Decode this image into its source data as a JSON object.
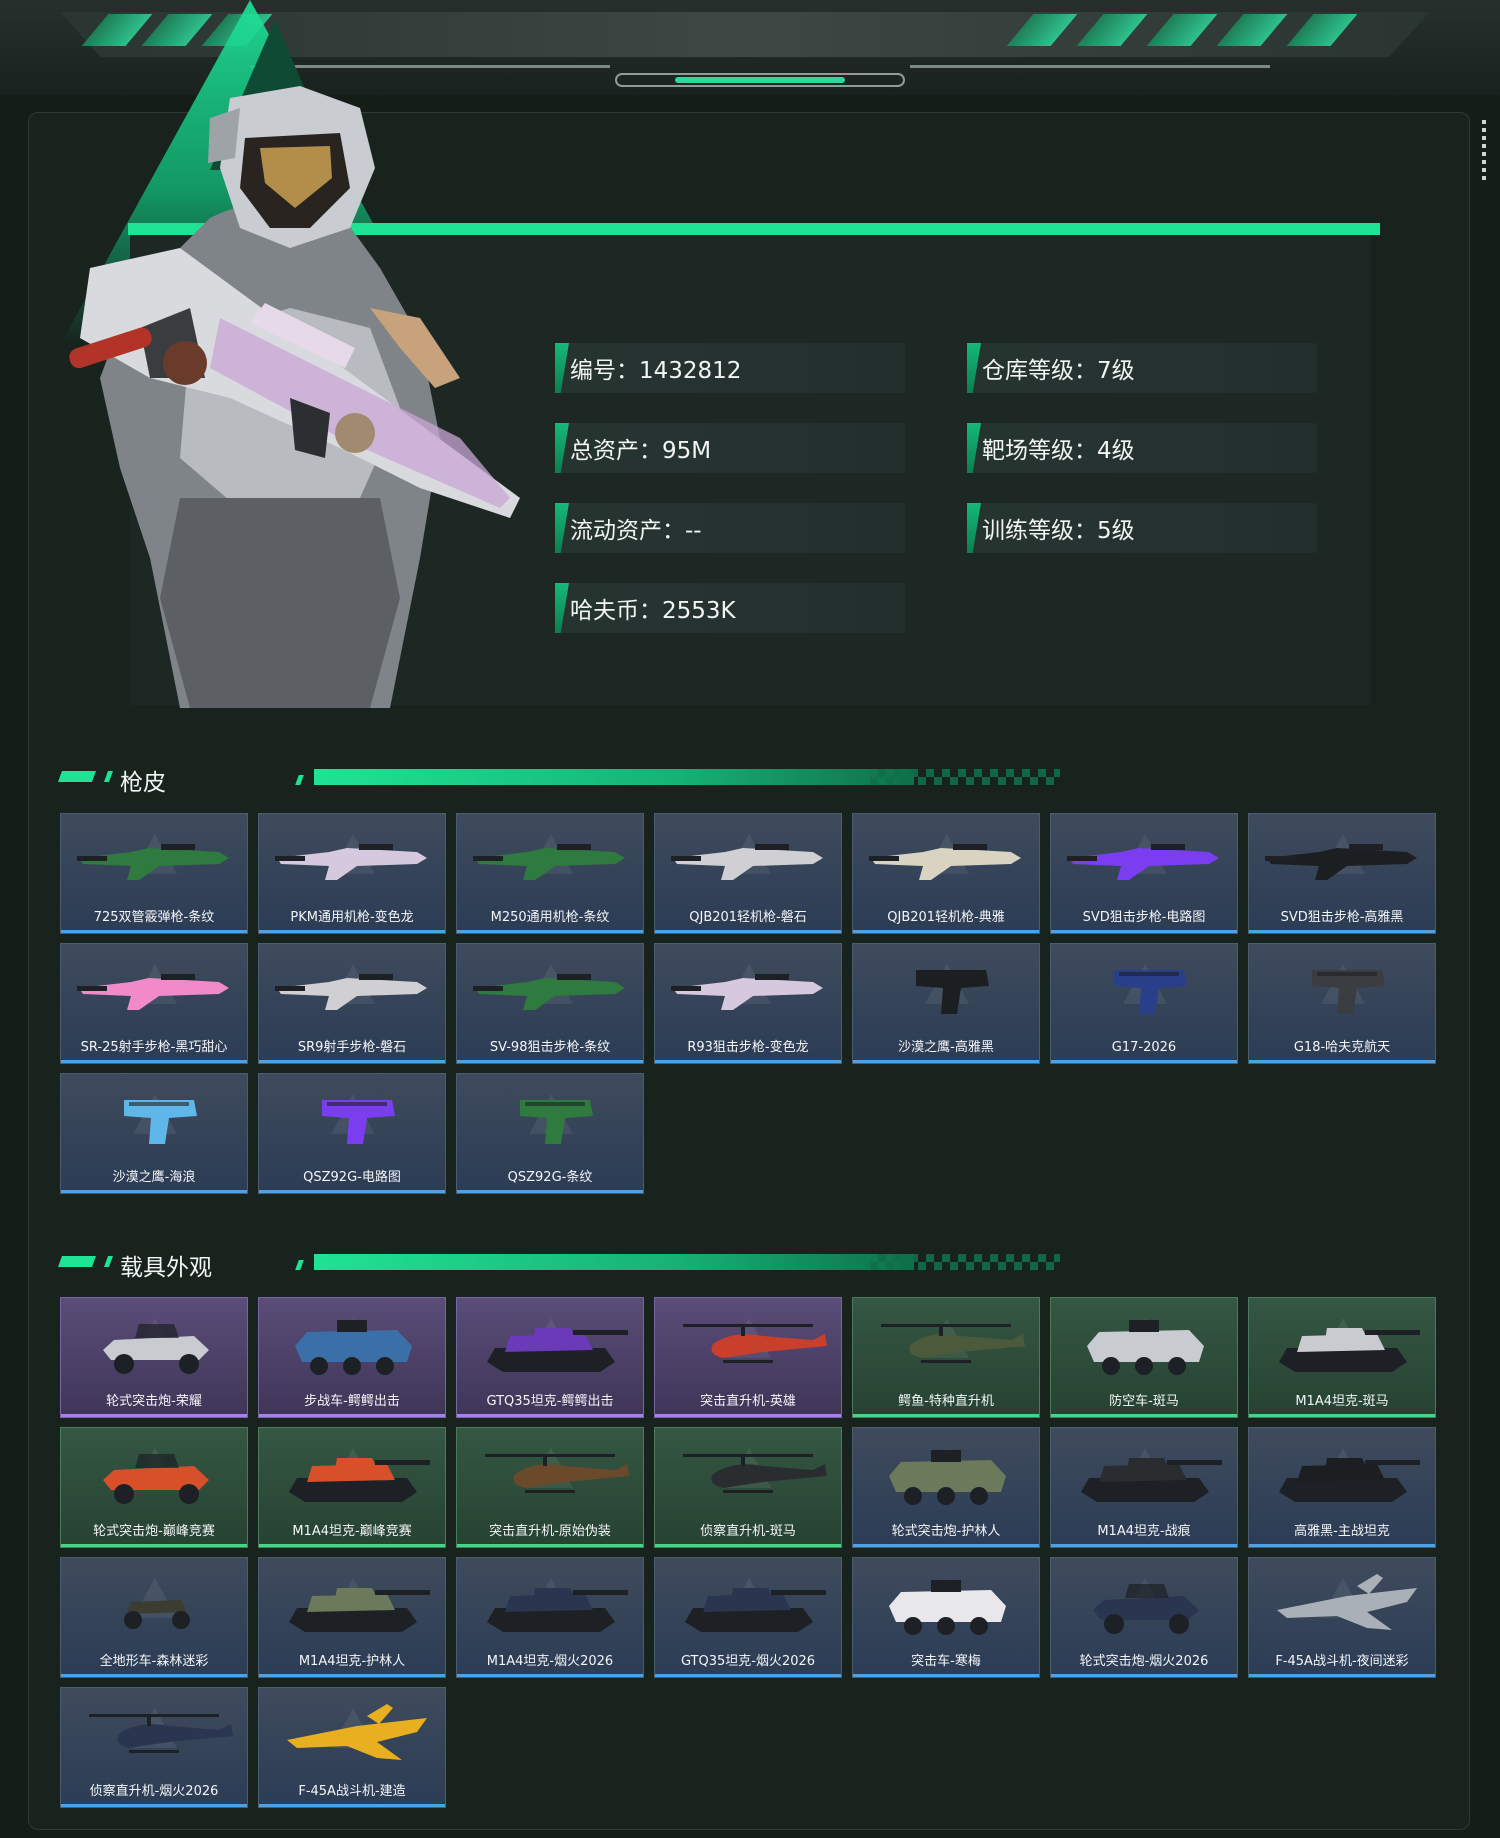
{
  "profile": {
    "stats": [
      {
        "label": "编号：1432812"
      },
      {
        "label": "仓库等级：7级"
      },
      {
        "label": "总资产：95M"
      },
      {
        "label": "靶场等级：4级"
      },
      {
        "label": "流动资产：--"
      },
      {
        "label": "训练等级：5级"
      },
      {
        "label": "哈夫币：2553K"
      }
    ]
  },
  "sections": {
    "skins_title": "枪皮",
    "vehicles_title": "载具外观"
  },
  "skins": [
    {
      "name": "725双管霰弹枪-条纹",
      "kind": "gun",
      "tint": "blue",
      "color": "#2f7a3e"
    },
    {
      "name": "PKM通用机枪-变色龙",
      "kind": "gun",
      "tint": "blue",
      "color": "#d6c8df"
    },
    {
      "name": "M250通用机枪-条纹",
      "kind": "gun",
      "tint": "blue",
      "color": "#2f7a3e"
    },
    {
      "name": "QJB201轻机枪-磐石",
      "kind": "gun",
      "tint": "blue",
      "color": "#d0d0d4"
    },
    {
      "name": "QJB201轻机枪-典雅",
      "kind": "gun",
      "tint": "blue",
      "color": "#d9d3c2"
    },
    {
      "name": "SVD狙击步枪-电路图",
      "kind": "gun",
      "tint": "blue",
      "color": "#7a3ef0"
    },
    {
      "name": "SVD狙击步枪-高雅黑",
      "kind": "gun",
      "tint": "blue",
      "color": "#1c1f22"
    },
    {
      "name": "SR-25射手步枪-黑巧甜心",
      "kind": "gun",
      "tint": "blue",
      "color": "#f08ac8"
    },
    {
      "name": "SR9射手步枪-磐石",
      "kind": "gun",
      "tint": "blue",
      "color": "#d0d0d4"
    },
    {
      "name": "SV-98狙击步枪-条纹",
      "kind": "gun",
      "tint": "blue",
      "color": "#2f7a3e"
    },
    {
      "name": "R93狙击步枪-变色龙",
      "kind": "gun",
      "tint": "blue",
      "color": "#d6c8df"
    },
    {
      "name": "沙漠之鹰-高雅黑",
      "kind": "pistol",
      "tint": "blue",
      "color": "#1c1f22"
    },
    {
      "name": "G17-2026",
      "kind": "pistol",
      "tint": "blue",
      "color": "#2a3f8a"
    },
    {
      "name": "G18-哈夫克航天",
      "kind": "pistol",
      "tint": "blue",
      "color": "#3a3d42"
    },
    {
      "name": "沙漠之鹰-海浪",
      "kind": "pistol",
      "tint": "blue",
      "color": "#5fb6e8"
    },
    {
      "name": "QSZ92G-电路图",
      "kind": "pistol",
      "tint": "blue",
      "color": "#7a3ef0"
    },
    {
      "name": "QSZ92G-条纹",
      "kind": "pistol",
      "tint": "blue",
      "color": "#2f7a3e"
    }
  ],
  "vehicles": [
    {
      "name": "轮式突击炮-荣耀",
      "kind": "buggy",
      "tint": "purple",
      "color": "#c8ccd0"
    },
    {
      "name": "步战车-鳄鳄出击",
      "kind": "apc",
      "tint": "purple",
      "color": "#3a6fa8"
    },
    {
      "name": "GTQ35坦克-鳄鳄出击",
      "kind": "tank",
      "tint": "purple",
      "color": "#6a3ab8"
    },
    {
      "name": "突击直升机-英雄",
      "kind": "heli",
      "tint": "purple",
      "color": "#c8402c"
    },
    {
      "name": "鳄鱼-特种直升机",
      "kind": "heli",
      "tint": "green",
      "color": "#4a5a3a"
    },
    {
      "name": "防空车-斑马",
      "kind": "apc",
      "tint": "green",
      "color": "#c8ccd0"
    },
    {
      "name": "M1A4坦克-斑马",
      "kind": "tank",
      "tint": "green",
      "color": "#c8ccd0"
    },
    {
      "name": "轮式突击炮-巅峰竞赛",
      "kind": "buggy",
      "tint": "green",
      "color": "#d8502a"
    },
    {
      "name": "M1A4坦克-巅峰竞赛",
      "kind": "tank",
      "tint": "green",
      "color": "#d8502a"
    },
    {
      "name": "突击直升机-原始伪装",
      "kind": "heli",
      "tint": "green",
      "color": "#6a4a2a"
    },
    {
      "name": "侦察直升机-斑马",
      "kind": "heli",
      "tint": "green",
      "color": "#2a2d30"
    },
    {
      "name": "轮式突击炮-护林人",
      "kind": "apc",
      "tint": "blue",
      "color": "#6a7a5a"
    },
    {
      "name": "M1A4坦克-战痕",
      "kind": "tank",
      "tint": "blue",
      "color": "#2a2d30"
    },
    {
      "name": "高雅黑-主战坦克",
      "kind": "tank",
      "tint": "blue",
      "color": "#1c1f22"
    },
    {
      "name": "全地形车-森林迷彩",
      "kind": "atv",
      "tint": "blue",
      "color": "#3a3d30"
    },
    {
      "name": "M1A4坦克-护林人",
      "kind": "tank",
      "tint": "blue",
      "color": "#6a7a5a"
    },
    {
      "name": "M1A4坦克-烟火2026",
      "kind": "tank",
      "tint": "blue",
      "color": "#2a3550"
    },
    {
      "name": "GTQ35坦克-烟火2026",
      "kind": "tank",
      "tint": "blue",
      "color": "#2a3550"
    },
    {
      "name": "突击车-寒梅",
      "kind": "apc",
      "tint": "blue",
      "color": "#e8e8ec"
    },
    {
      "name": "轮式突击炮-烟火2026",
      "kind": "buggy",
      "tint": "blue",
      "color": "#2a3550"
    },
    {
      "name": "F-45A战斗机-夜间迷彩",
      "kind": "jet",
      "tint": "blue",
      "color": "#aab0b8"
    },
    {
      "name": "侦察直升机-烟火2026",
      "kind": "heli",
      "tint": "blue",
      "color": "#2a3550"
    },
    {
      "name": "F-45A战斗机-建造",
      "kind": "jet",
      "tint": "blue",
      "color": "#e8b020"
    }
  ]
}
